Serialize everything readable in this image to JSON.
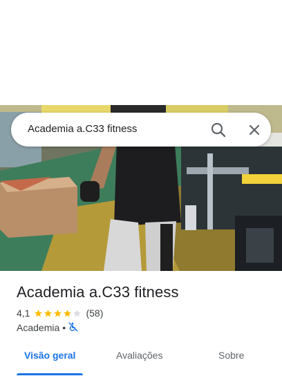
{
  "search": {
    "query": "Academia a.C33 fitness",
    "search_icon": "search-icon",
    "close_icon": "close-icon"
  },
  "photo": {
    "icon": "gym-photo"
  },
  "place": {
    "title": "Academia a.C33 fitness",
    "rating": "4,1",
    "stars_filled": 4,
    "stars_total": 5,
    "review_count": "(58)",
    "category": "Academia",
    "separator": "•",
    "accessibility_icon": "wheelchair-not-accessible-icon"
  },
  "tabs": [
    {
      "label": "Visão geral",
      "active": true
    },
    {
      "label": "Avaliações",
      "active": false
    },
    {
      "label": "Sobre",
      "active": false
    }
  ],
  "colors": {
    "accent": "#1a73e8",
    "star": "#fbbc04",
    "star_empty": "#dadce0"
  }
}
